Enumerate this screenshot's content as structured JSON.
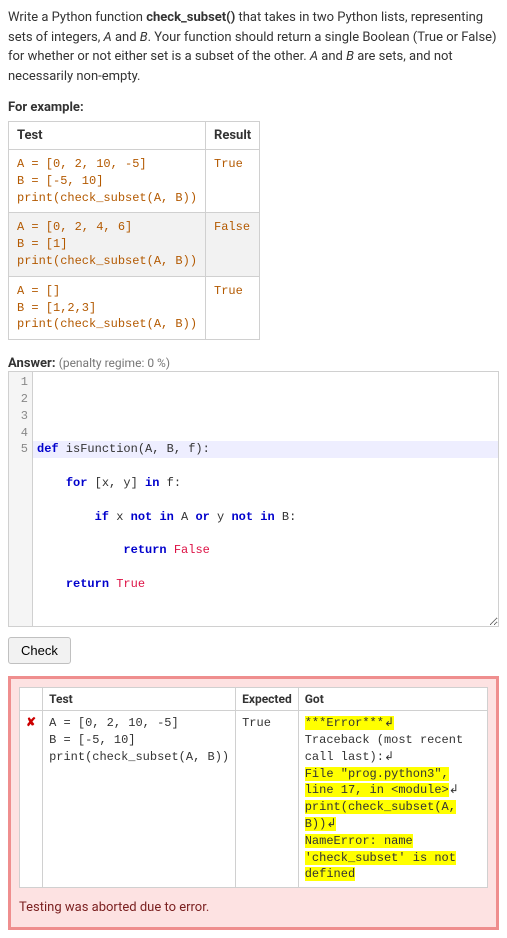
{
  "question": {
    "prefix": "Write a Python function ",
    "func_name": "check_subset()",
    "part2": " that takes in two Python lists, representing sets of integers, ",
    "varA": "A",
    "part3": " and ",
    "varB": "B",
    "part4": ". Your function should return a single Boolean (True or False) for whether or not either set is a subset of the other. ",
    "varA2": "A",
    "part5": " and ",
    "varB2": "B",
    "part6": " are sets, and not necessarily non-empty."
  },
  "example_label": "For example:",
  "example_table": {
    "headers": [
      "Test",
      "Result"
    ],
    "rows": [
      {
        "test": "A = [0, 2, 10, -5]\nB = [-5, 10]\nprint(check_subset(A, B))",
        "result": "True"
      },
      {
        "test": "A = [0, 2, 4, 6]\nB = [1]\nprint(check_subset(A, B))",
        "result": "False"
      },
      {
        "test": "A = []\nB = [1,2,3]\nprint(check_subset(A, B))",
        "result": "True"
      }
    ]
  },
  "answer_label": "Answer:",
  "penalty": "(penalty regime: 0 %)",
  "editor": {
    "line_numbers": "1\n2\n3\n4\n5",
    "line1": {
      "kw1": "def",
      "rest": " isFunction(A, B, f):"
    },
    "line2": {
      "kw1": "for",
      "mid": " [x, y] ",
      "kw2": "in",
      "rest": " f:"
    },
    "line3": {
      "kw1": "if",
      "mid1": " x ",
      "kw2": "not",
      "sp1": " ",
      "kw3": "in",
      "mid2": " A ",
      "kw4": "or",
      "mid3": " y ",
      "kw5": "not",
      "sp2": " ",
      "kw6": "in",
      "rest": " B:"
    },
    "line4": {
      "kw1": "return",
      "sp": " ",
      "val": "False"
    },
    "line5": {
      "kw1": "return",
      "sp": " ",
      "val": "True"
    }
  },
  "check_button": "Check",
  "result": {
    "headers": [
      "",
      "Test",
      "Expected",
      "Got"
    ],
    "mark": "✘",
    "test": "A = [0, 2, 10, -5]\nB = [-5, 10]\nprint(check_subset(A, B))",
    "expected": "True",
    "got": {
      "l1": "***Error***↲",
      "l2": "Traceback (most recent call last):↲",
      "l3a": "  File \"prog.python3\", line 17, in <module>",
      "l3b": "↲",
      "l4": "    print(check_subset(A, B))↲",
      "l5": "NameError: name 'check_subset' is not defined"
    },
    "message": "Testing was aborted due to error."
  }
}
